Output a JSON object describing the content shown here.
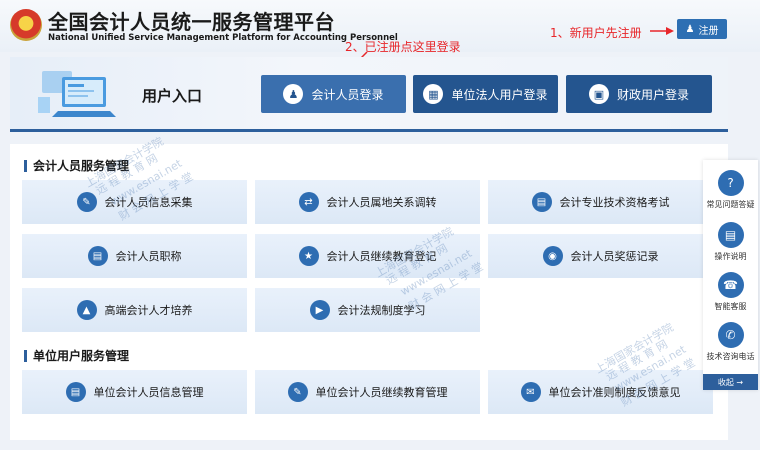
{
  "header": {
    "title": "全国会计人员统一服务管理平台",
    "subtitle": "National Unified Service Management Platform for Accounting Personnel",
    "hint_new_user": "1、新用户先注册",
    "hint_registered": "2、已注册点这里登录",
    "register_label": "注册"
  },
  "entry": {
    "title": "用户入口",
    "login_accountant": "会计人员登录",
    "login_corporate": "单位法人用户登录",
    "login_finance": "财政用户登录"
  },
  "sections": {
    "accountant_title": "会计人员服务管理",
    "unit_title": "单位用户服务管理"
  },
  "accountant_services": [
    {
      "label": "会计人员信息采集",
      "icon": "form-icon"
    },
    {
      "label": "会计人员属地关系调转",
      "icon": "transfer-icon"
    },
    {
      "label": "会计专业技术资格考试",
      "icon": "exam-icon"
    },
    {
      "label": "会计人员职称",
      "icon": "title-icon"
    },
    {
      "label": "会计人员继续教育登记",
      "icon": "education-icon"
    },
    {
      "label": "会计人员奖惩记录",
      "icon": "record-icon"
    },
    {
      "label": "高端会计人才培养",
      "icon": "graduation-cap-icon"
    },
    {
      "label": "会计法规制度学习",
      "icon": "play-icon"
    }
  ],
  "unit_services": [
    {
      "label": "单位会计人员信息管理",
      "icon": "info-manage-icon"
    },
    {
      "label": "单位会计人员继续教育管理",
      "icon": "edu-manage-icon"
    },
    {
      "label": "单位会计准则制度反馈意见",
      "icon": "feedback-icon"
    }
  ],
  "side_panel": {
    "faq": "常见问题答疑",
    "manual": "操作说明",
    "service": "智能客服",
    "phone": "技术咨询电话",
    "collapse": "收起 →"
  },
  "watermark": {
    "line1": "上海国家会计学院",
    "line2": "远 程 教 育 网",
    "line3": "www.esnai.net",
    "line4": "财 会 网 上 学 堂"
  },
  "colors": {
    "primary": "#24558f",
    "accent_red": "#e8262a",
    "card_bg": "#e2ecf8"
  }
}
